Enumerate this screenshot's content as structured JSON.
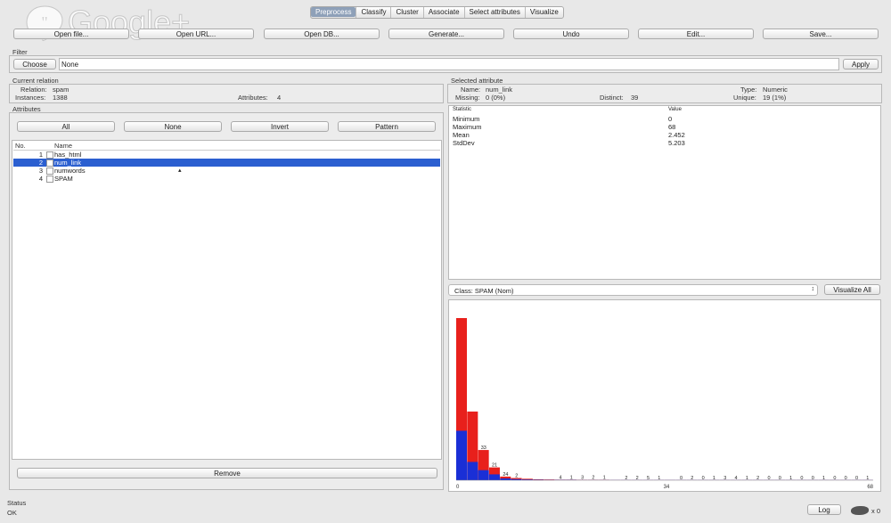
{
  "watermark": {
    "text": "Google+"
  },
  "tabs": [
    "Preprocess",
    "Classify",
    "Cluster",
    "Associate",
    "Select attributes",
    "Visualize"
  ],
  "toolbar": {
    "open_file": "Open file...",
    "open_url": "Open URL...",
    "open_db": "Open DB...",
    "generate": "Generate...",
    "undo": "Undo",
    "edit": "Edit...",
    "save": "Save..."
  },
  "filter": {
    "section": "Filter",
    "choose": "Choose",
    "value": "None",
    "apply": "Apply"
  },
  "current_relation": {
    "section": "Current relation",
    "relation_label": "Relation:",
    "relation": "spam",
    "instances_label": "Instances:",
    "instances": "1388",
    "attributes_label": "Attributes:",
    "attributes": "4"
  },
  "attributes": {
    "section": "Attributes",
    "all": "All",
    "none": "None",
    "invert": "Invert",
    "pattern": "Pattern",
    "col_no": "No.",
    "col_name": "Name",
    "rows": [
      {
        "no": "1",
        "name": "has_html"
      },
      {
        "no": "2",
        "name": "num_link"
      },
      {
        "no": "3",
        "name": "numwords"
      },
      {
        "no": "4",
        "name": "SPAM"
      }
    ],
    "remove": "Remove"
  },
  "selected_attribute": {
    "section": "Selected attribute",
    "name_label": "Name:",
    "name": "num_link",
    "type_label": "Type:",
    "type": "Numeric",
    "missing_label": "Missing:",
    "missing": "0 (0%)",
    "distinct_label": "Distinct:",
    "distinct": "39",
    "unique_label": "Unique:",
    "unique": "19 (1%)",
    "stat_col": "Statistic",
    "value_col": "Value",
    "stats": [
      {
        "k": "Minimum",
        "v": "0"
      },
      {
        "k": "Maximum",
        "v": "68"
      },
      {
        "k": "Mean",
        "v": "2.452"
      },
      {
        "k": "StdDev",
        "v": "5.203"
      }
    ]
  },
  "class_select": {
    "value": "Class: SPAM (Nom)"
  },
  "visualize_all": "Visualize All",
  "colors": {
    "red": "#e8201c",
    "blue": "#1a2fd6",
    "selected": "#2b5fd0"
  },
  "chart_data": {
    "type": "bar",
    "title": "",
    "xlim": [
      0,
      68
    ],
    "x_ticks": [
      "0",
      "34",
      "68"
    ],
    "series": [
      {
        "name": "",
        "values": [
          885,
          375,
          165,
          70,
          20,
          12,
          8,
          5,
          4,
          3,
          3,
          2,
          2,
          2,
          1,
          1,
          1,
          1,
          1,
          1,
          1,
          1,
          1,
          1,
          1,
          1,
          1,
          1,
          1,
          1,
          1,
          1,
          1,
          1,
          1,
          1,
          1,
          1
        ]
      },
      {
        "name": "",
        "values": [
          270,
          100,
          55,
          32,
          10,
          6,
          4,
          3,
          2,
          2,
          2,
          1,
          1,
          1,
          1,
          1,
          1,
          1,
          1,
          1,
          1,
          1,
          1,
          1,
          1,
          1,
          1,
          1,
          1,
          1,
          1,
          1,
          1,
          1,
          1,
          1,
          1,
          1
        ]
      }
    ],
    "bar_labels": [
      "",
      "",
      "33",
      "21",
      "24",
      "2",
      "",
      "",
      "",
      "4",
      "1",
      "3",
      "2",
      "1",
      "",
      "2",
      "2",
      "5",
      "1",
      "",
      "0",
      "2",
      "0",
      "1",
      "3",
      "4",
      "1",
      "2",
      "0",
      "0",
      "1",
      "0",
      "0",
      "1",
      "0",
      "0",
      "0",
      "1"
    ]
  },
  "status": {
    "section": "Status",
    "text": "OK",
    "log": "Log",
    "count": "x 0"
  }
}
